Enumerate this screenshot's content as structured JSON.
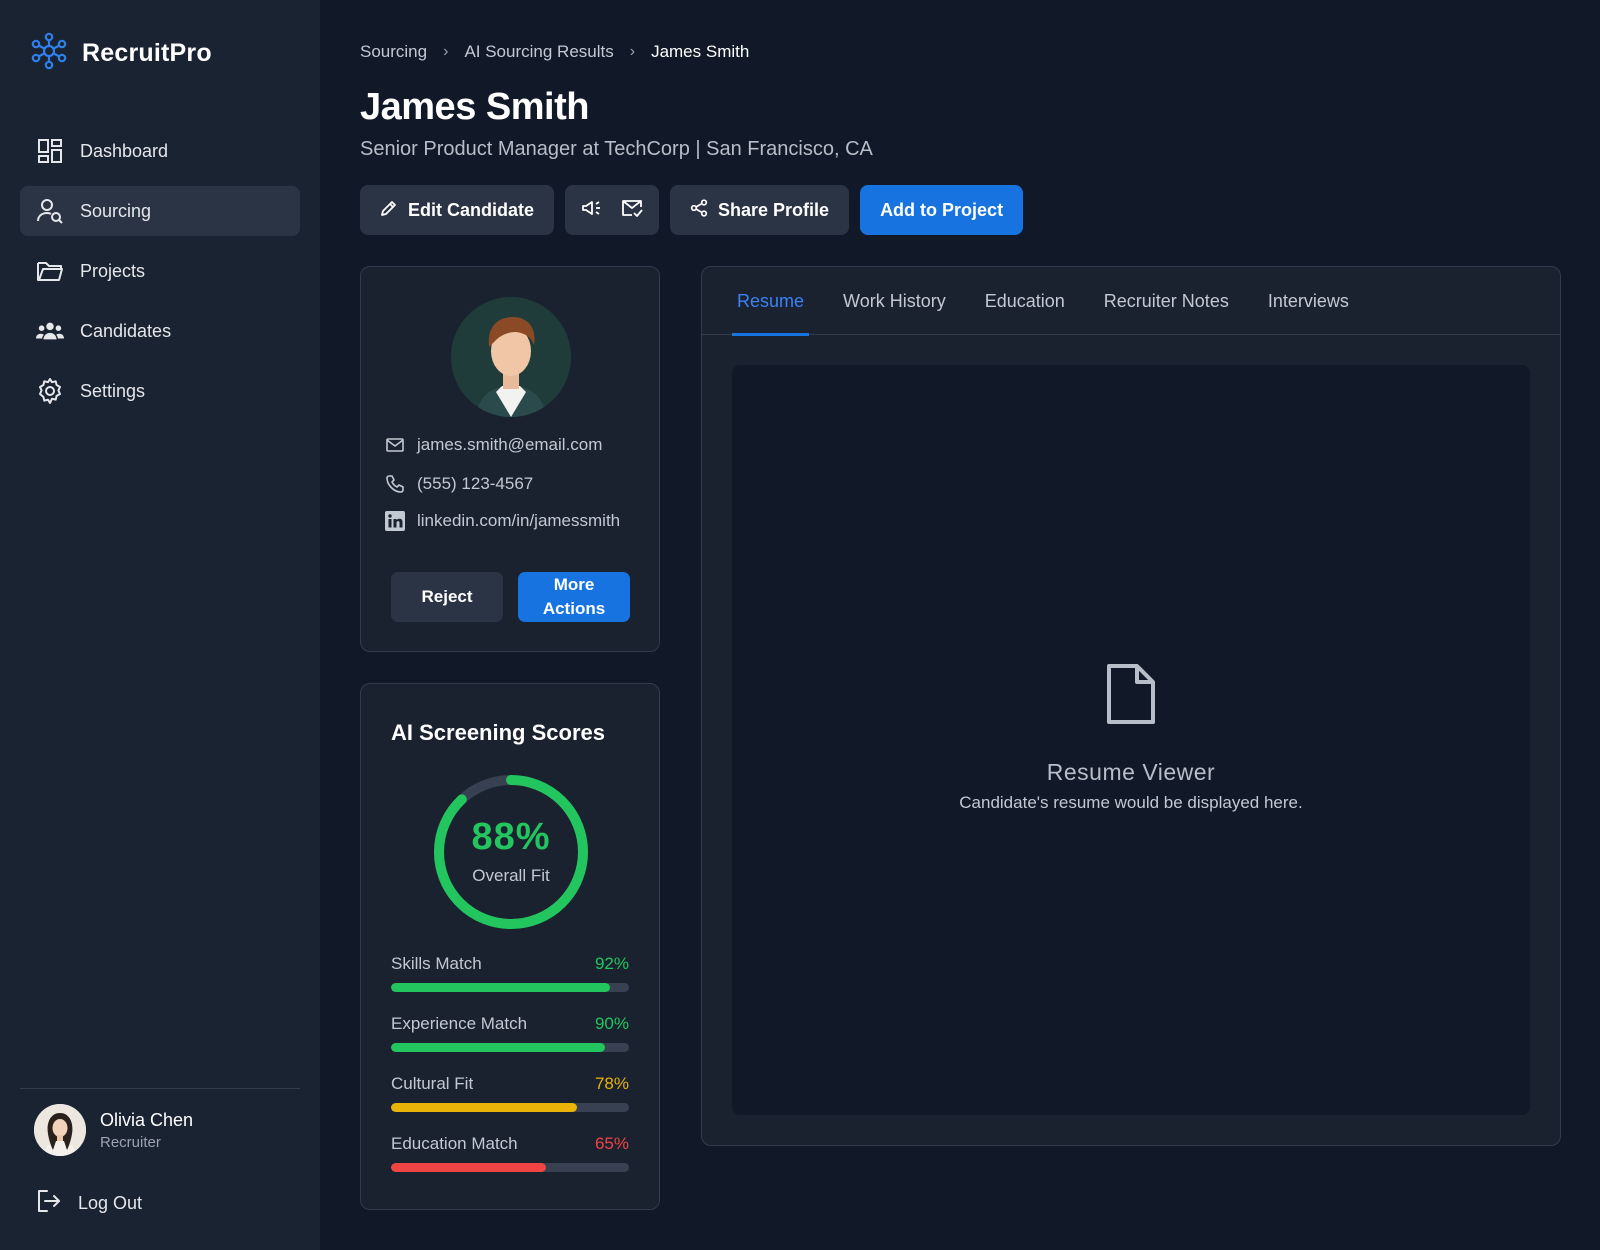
{
  "app": {
    "name": "RecruitPro"
  },
  "nav": {
    "items": [
      {
        "label": "Dashboard",
        "icon": "dashboard-icon"
      },
      {
        "label": "Sourcing",
        "icon": "user-search-icon",
        "active": true
      },
      {
        "label": "Projects",
        "icon": "folder-icon"
      },
      {
        "label": "Candidates",
        "icon": "users-icon"
      },
      {
        "label": "Settings",
        "icon": "gear-icon"
      }
    ]
  },
  "user": {
    "name": "Olivia Chen",
    "role": "Recruiter"
  },
  "logout_label": "Log Out",
  "breadcrumb": [
    "Sourcing",
    "AI Sourcing Results",
    "James Smith"
  ],
  "candidate": {
    "name": "James Smith",
    "subtitle": "Senior Product Manager at TechCorp | San Francisco, CA",
    "email": "james.smith@email.com",
    "phone": "(555) 123-4567",
    "linkedin": "linkedin.com/in/jamessmith"
  },
  "actions": {
    "edit": "Edit Candidate",
    "share": "Share Profile",
    "add": "Add to Project"
  },
  "card_buttons": {
    "reject": "Reject",
    "more": "More Actions"
  },
  "scores": {
    "title": "AI Screening Scores",
    "overall_value": "88%",
    "overall_fraction": 0.88,
    "overall_label": "Overall Fit",
    "metrics": [
      {
        "label": "Skills Match",
        "display": "92%",
        "value": 92,
        "color": "#22c55e"
      },
      {
        "label": "Experience Match",
        "display": "90%",
        "value": 90,
        "color": "#22c55e"
      },
      {
        "label": "Cultural Fit",
        "display": "78%",
        "value": 78,
        "color": "#eab308"
      },
      {
        "label": "Education Match",
        "display": "65%",
        "value": 65,
        "color": "#ef4444"
      }
    ]
  },
  "tabs": [
    "Resume",
    "Work History",
    "Education",
    "Recruiter Notes",
    "Interviews"
  ],
  "viewer": {
    "title": "Resume Viewer",
    "subtitle": "Candidate's resume would be displayed here."
  },
  "colors": {
    "accent": "#1673e0",
    "success": "#22c55e",
    "warning": "#eab308",
    "danger": "#ef4444"
  }
}
